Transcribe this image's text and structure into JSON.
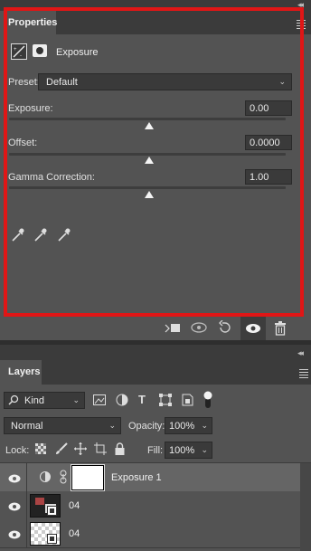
{
  "properties_panel": {
    "tab_label": "Properties",
    "adjustment_name": "Exposure",
    "preset_label": "Preset:",
    "preset_value": "Default",
    "exposure_label": "Exposure:",
    "exposure_value": "0.00",
    "offset_label": "Offset:",
    "offset_value": "0.0000",
    "gamma_label": "Gamma Correction:",
    "gamma_value": "1.00"
  },
  "layers_panel": {
    "tab_label": "Layers",
    "filter_kind": "Kind",
    "blend_mode": "Normal",
    "opacity_label": "Opacity:",
    "opacity_value": "100%",
    "lock_label": "Lock:",
    "fill_label": "Fill:",
    "fill_value": "100%",
    "layers": [
      {
        "name": "Exposure 1",
        "selected": true
      },
      {
        "name": "04",
        "selected": false
      },
      {
        "name": "04",
        "selected": false
      }
    ]
  },
  "colors": {
    "highlight_frame": "#e01616",
    "panel_bg": "#535353",
    "field_bg": "#3a3a3a"
  }
}
